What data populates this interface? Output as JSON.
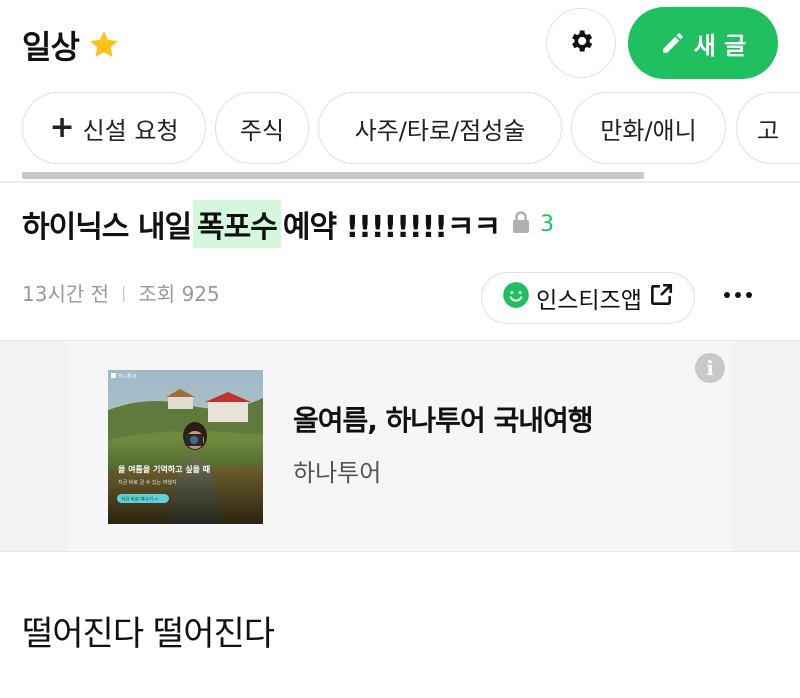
{
  "header": {
    "board_name": "일상",
    "star_icon": "star-icon",
    "settings_icon": "gear-icon",
    "write_button_label": "새 글",
    "write_icon": "pencil-icon",
    "accent_color": "#20c060"
  },
  "chips": [
    {
      "label": "신설 요청",
      "icon": "plus-icon"
    },
    {
      "label": "주식"
    },
    {
      "label": "사주/타로/점성술"
    },
    {
      "label": "만화/애니"
    },
    {
      "label": "고"
    }
  ],
  "post": {
    "title_before": "하이닉스 내일",
    "title_highlight": "폭포수",
    "title_after": "예약 !!!!!!!!ㅋㅋ",
    "comment_count": "3",
    "time_ago": "13시간 전",
    "views": "조회 925",
    "body": "떨어진다 떨어진다"
  },
  "app_button": {
    "label": "인스티즈앱"
  },
  "ad": {
    "title": "올여름, 하나투어 국내여행",
    "advertiser": "하나투어",
    "info_label": "i",
    "image_brand": "하나투어",
    "image_headline": "올 여름을 기억하고 싶을 때",
    "image_sub": "지금 바로 갈 수 있는 여행지",
    "image_cta": "지금 바로 떠나기 >"
  }
}
